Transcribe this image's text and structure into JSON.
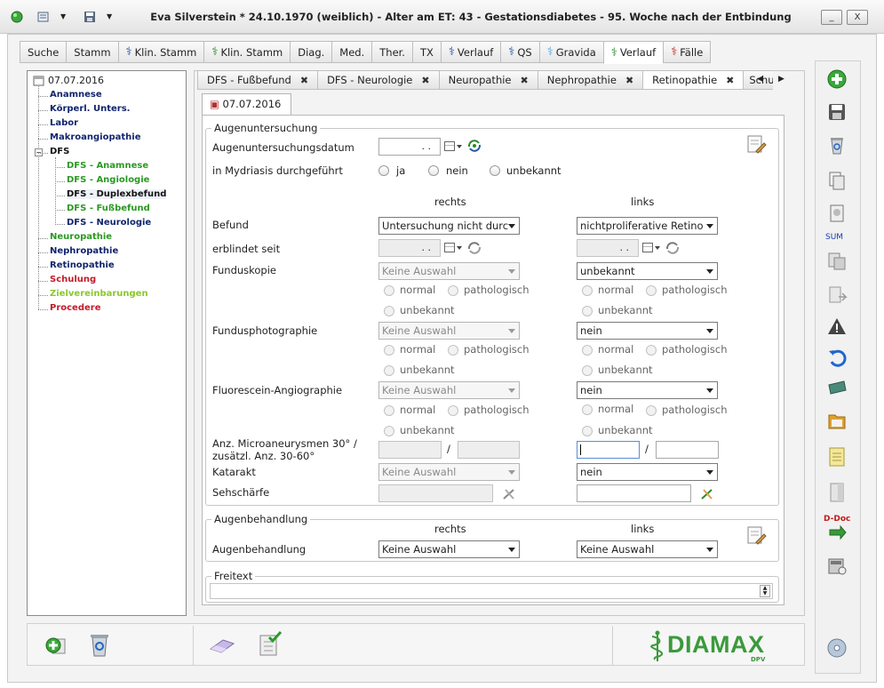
{
  "window": {
    "title": "Eva Silverstein  * 24.10.1970 (weiblich) - Alter am ET: 43 - Gestationsdiabetes - 95. Woche nach der Entbindung",
    "minimize": "_",
    "close": "X"
  },
  "main_tabs": [
    {
      "label": "Suche",
      "icon": ""
    },
    {
      "label": "Stamm",
      "icon": ""
    },
    {
      "label": "Klin. Stamm",
      "icon": "blue"
    },
    {
      "label": "Klin. Stamm",
      "icon": "green"
    },
    {
      "label": "Diag.",
      "icon": ""
    },
    {
      "label": "Med.",
      "icon": ""
    },
    {
      "label": "Ther.",
      "icon": ""
    },
    {
      "label": "TX",
      "icon": ""
    },
    {
      "label": "Verlauf",
      "icon": "blue"
    },
    {
      "label": "QS",
      "icon": "blue"
    },
    {
      "label": "Gravida",
      "icon": "lblue"
    },
    {
      "label": "Verlauf",
      "icon": "green",
      "active": true
    },
    {
      "label": "Fälle",
      "icon": "red"
    }
  ],
  "tree": {
    "root": "07.07.2016",
    "items": [
      {
        "label": "Anamnese",
        "color": "navy"
      },
      {
        "label": "Körperl. Unters.",
        "color": "navy"
      },
      {
        "label": "Labor",
        "color": "navy"
      },
      {
        "label": "Makroangiopathie",
        "color": "navy"
      },
      {
        "label": "DFS",
        "color": "black"
      },
      {
        "label": "DFS - Anamnese",
        "color": "green"
      },
      {
        "label": "DFS - Angiologie",
        "color": "green"
      },
      {
        "label": "DFS - Duplexbefund",
        "color": "black"
      },
      {
        "label": "DFS - Fußbefund",
        "color": "green"
      },
      {
        "label": "DFS - Neurologie",
        "color": "navy"
      },
      {
        "label": "Neuropathie",
        "color": "green"
      },
      {
        "label": "Nephropathie",
        "color": "navy"
      },
      {
        "label": "Retinopathie",
        "color": "navy"
      },
      {
        "label": "Schulung",
        "color": "red"
      },
      {
        "label": "Zielvereinbarungen",
        "color": "lime"
      },
      {
        "label": "Procedere",
        "color": "red"
      }
    ]
  },
  "sub_tabs": [
    "DFS - Fußbefund",
    "DFS - Neurologie",
    "Neuropathie",
    "Nephropathie",
    "Retinopathie",
    "Schu"
  ],
  "date_tab": "07.07.2016",
  "augenuntersuchung": {
    "legend": "Augenuntersuchung",
    "datum_label": "Augenuntersuchungsdatum",
    "datum_value": ". .",
    "mydriasis_label": "in Mydriasis durchgeführt",
    "mydriasis_options": [
      "ja",
      "nein",
      "unbekannt"
    ],
    "col_rechts": "rechts",
    "col_links": "links",
    "befund_label": "Befund",
    "befund_rechts": "Untersuchung nicht durc",
    "befund_links": "nichtproliferative Retino",
    "erblindet_label": "erblindet seit",
    "date_placeholder": ". .",
    "funduskopie_label": "Funduskopie",
    "funduskopie_rechts": "Keine Auswahl",
    "funduskopie_links": "unbekannt",
    "fundusphoto_label": "Fundusphotographie",
    "fundusphoto_rechts": "Keine Auswahl",
    "fundusphoto_links": "nein",
    "fluorescein_label": "Fluorescein-Angiographie",
    "fluorescein_rechts": "Keine Auswahl",
    "fluorescein_links": "nein",
    "opt_normal": "normal",
    "opt_patho": "pathologisch",
    "opt_unbekannt": "unbekannt",
    "micro_label1": "Anz. Microaneurysmen 30° /",
    "micro_label2": "zusätzl. Anz. 30-60°",
    "slash": "/",
    "katarakt_label": "Katarakt",
    "katarakt_rechts": "Keine Auswahl",
    "katarakt_links": "nein",
    "sehschaerfe_label": "Sehschärfe"
  },
  "augenbehandlung": {
    "legend": "Augenbehandlung",
    "col_rechts": "rechts",
    "col_links": "links",
    "label": "Augenbehandlung",
    "rechts": "Keine Auswahl",
    "links": "Keine Auswahl"
  },
  "freitext": {
    "legend": "Freitext"
  },
  "toolbar": {
    "sum_label": "SUM",
    "ddoc_label": "D-Doc"
  },
  "logo": {
    "text": "DIAMAX",
    "sub": "DPV"
  }
}
